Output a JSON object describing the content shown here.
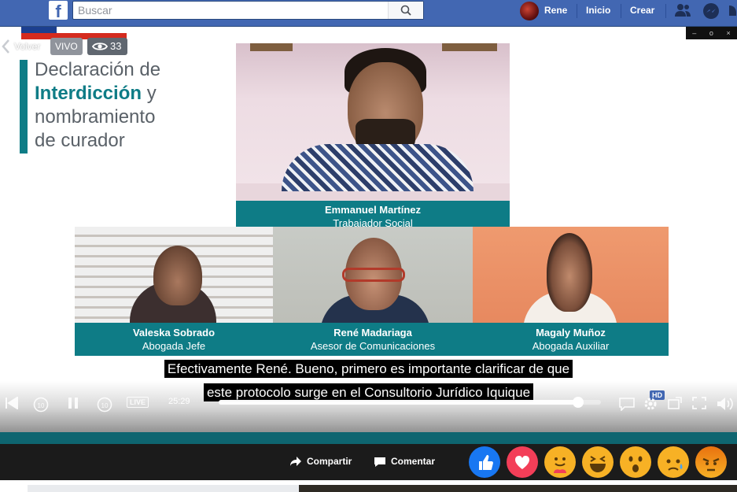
{
  "topbar": {
    "logo": "f",
    "search_placeholder": "Buscar",
    "user_name": "Rene",
    "nav_home": "Inicio",
    "nav_create": "Crear",
    "icons": [
      "facebook-logo-icon",
      "search-icon",
      "friends-icon",
      "messenger-icon",
      "notifications-icon"
    ],
    "bg_color": "#4267b2"
  },
  "video": {
    "back_label": "Volver",
    "live_label": "VIVO",
    "viewers": "33",
    "window_controls": [
      "–",
      "o",
      "×"
    ],
    "slide_title": {
      "line1": "Declaración de",
      "line2_strong": "Interdicción",
      "line2_rest": " y",
      "line3": "nombramiento",
      "line4": "de curador"
    },
    "main_speaker": {
      "name": "Emmanuel Martínez",
      "role": "Trabajador Social"
    },
    "panelists": [
      {
        "name": "Valeska Sobrado",
        "role": "Abogada Jefe"
      },
      {
        "name": "René Madariaga",
        "role": "Asesor de Comunicaciones"
      },
      {
        "name": "Magaly Muñoz",
        "role": "Abogada Auxiliar"
      }
    ],
    "subtitle": {
      "line1": "Efectivamente René. Bueno, primero es importante clarificar de que",
      "line2": "este protocolo surge en el Consultorio Jurídico Iquique"
    },
    "accent_color": "#0e7c86"
  },
  "player": {
    "elapsed": "25:29",
    "progress": 0.94,
    "hd_label": "HD",
    "live_button": "LIVE"
  },
  "actions": {
    "share": "Compartir",
    "comment": "Comentar",
    "reactions": [
      "like-icon",
      "love-icon",
      "care-icon",
      "haha-icon",
      "wow-icon",
      "sad-icon",
      "angry-icon"
    ]
  }
}
